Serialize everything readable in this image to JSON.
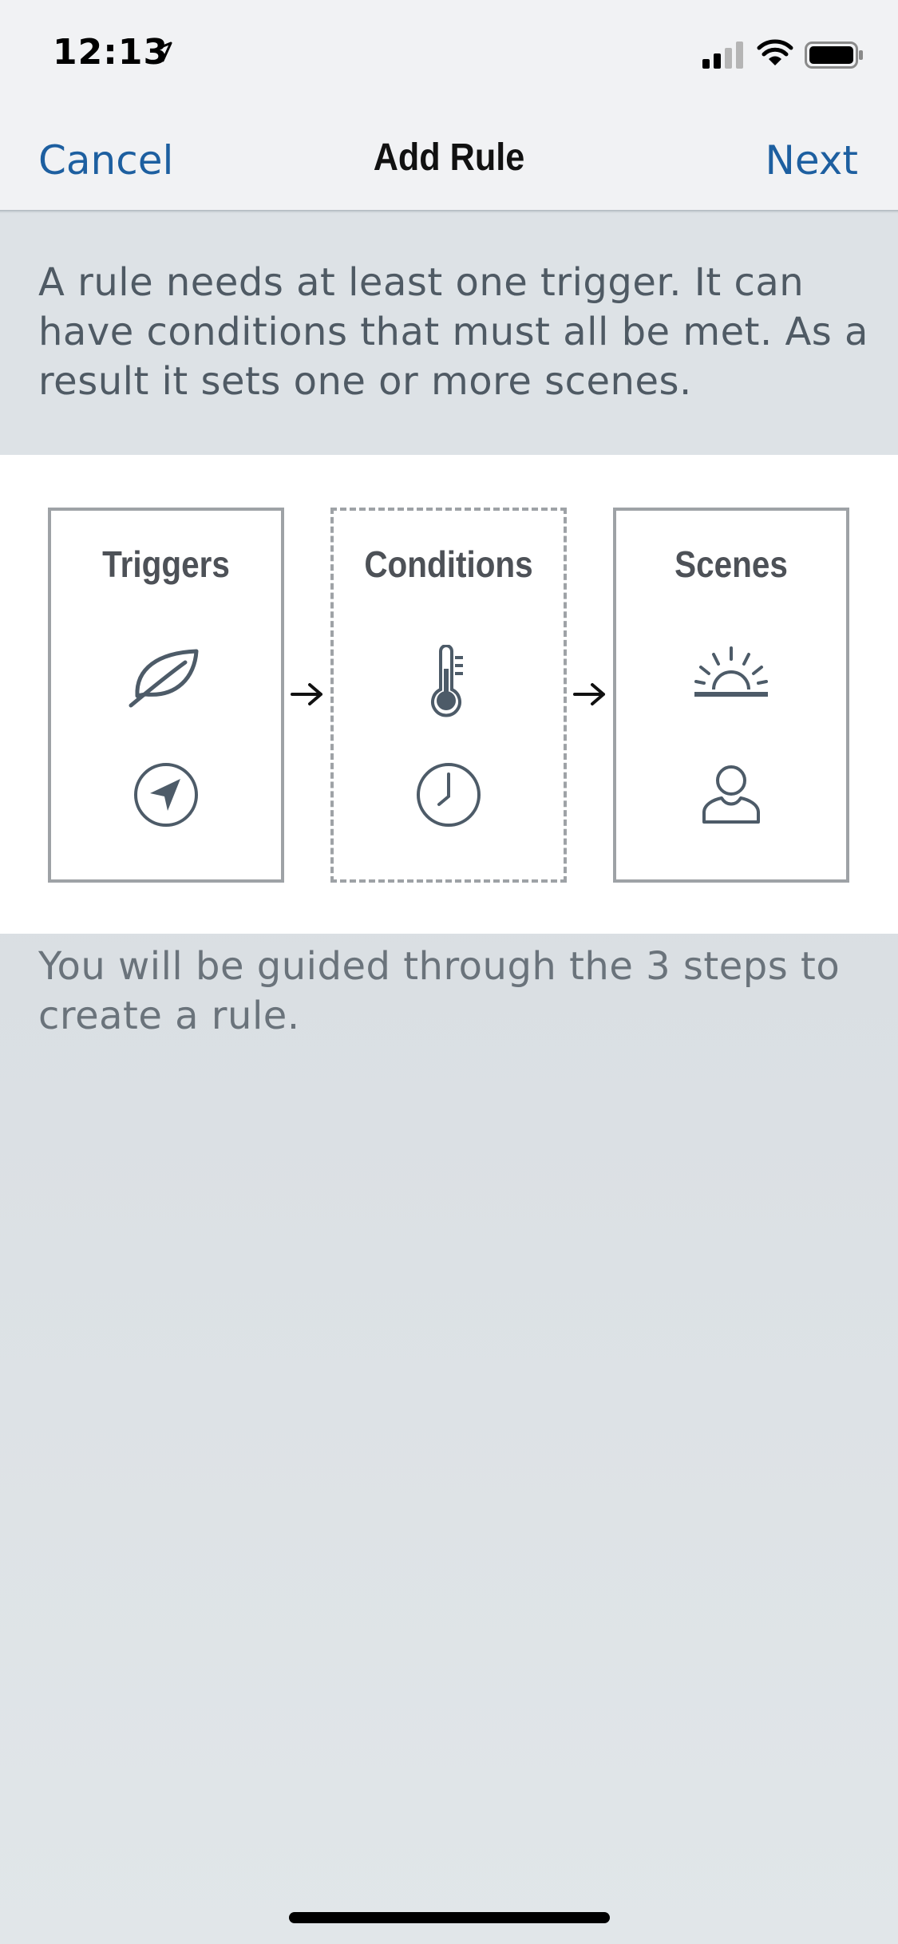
{
  "status_bar": {
    "time": "12:13",
    "icons": [
      "location-arrow-icon",
      "cellular-signal-icon",
      "wifi-icon",
      "battery-icon"
    ]
  },
  "nav": {
    "cancel_label": "Cancel",
    "title": "Add Rule",
    "next_label": "Next"
  },
  "intro": {
    "text": "A rule needs at least one trigger. It can have conditions that must all be met. As a result it sets one or more scenes."
  },
  "diagram": {
    "steps": [
      {
        "title": "Triggers",
        "icons": [
          "leaf-icon",
          "navigation-arrow-icon"
        ],
        "dashed": false
      },
      {
        "title": "Conditions",
        "icons": [
          "thermometer-icon",
          "clock-icon"
        ],
        "dashed": true
      },
      {
        "title": "Scenes",
        "icons": [
          "sunrise-icon",
          "person-icon"
        ],
        "dashed": false
      }
    ],
    "connector_icon": "arrow-right-icon"
  },
  "guide": {
    "text": "You will be guided through the 3 steps to create a rule."
  },
  "colors": {
    "accent": "#1d5fa0",
    "icon": "#4d5b68",
    "box_border": "#9ea2a6"
  }
}
